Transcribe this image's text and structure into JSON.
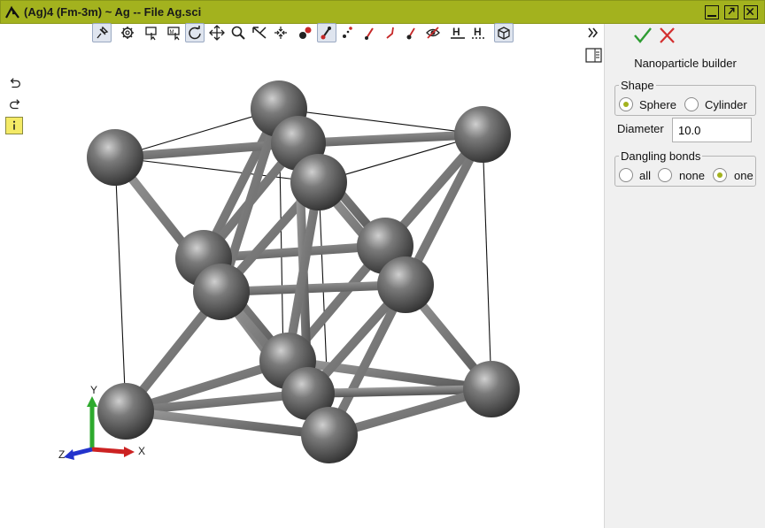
{
  "window": {
    "title": "(Ag)4  (Fm-3m) ~ Ag -- File Ag.sci",
    "controls": [
      "minimize-icon",
      "maximize-icon",
      "close-icon"
    ]
  },
  "toolbar": {
    "tools": [
      "pin-icon",
      "gear-icon",
      "select-rectangle-icon",
      "measure-icon",
      "rotate-icon",
      "zoom-icon",
      "transform-icon",
      "move-icon",
      "center-icon",
      "atom-pair-icon",
      "bond-icon",
      "dotted-bond-icon",
      "bond-red-icon",
      "bond-angle-icon",
      "bond-end-icon",
      "hide-icon",
      "hydrogen-icon",
      "hydrogen-dotted-icon",
      "cube-icon"
    ],
    "active": [
      "pin-icon",
      "rotate-icon",
      "bond-icon",
      "cube-icon"
    ]
  },
  "side_tools": [
    "undo-icon",
    "redo-icon",
    "info-icon"
  ],
  "axes": {
    "x": "X",
    "y": "Y",
    "z": "Z"
  },
  "panel": {
    "title": "Nanoparticle builder",
    "shape": {
      "legend": "Shape",
      "options": [
        "Sphere",
        "Cylinder"
      ],
      "selected": "Sphere"
    },
    "diameter": {
      "label": "Diameter",
      "value": "10.0"
    },
    "dangling": {
      "legend": "Dangling bonds",
      "options": [
        "all",
        "none",
        "one"
      ],
      "selected": "one"
    }
  },
  "colors": {
    "titlebar": "#a3b21e",
    "accept": "#2e9c32",
    "cancel": "#d32f2f",
    "atom": "#555555",
    "info_bg": "#f4ea66"
  }
}
